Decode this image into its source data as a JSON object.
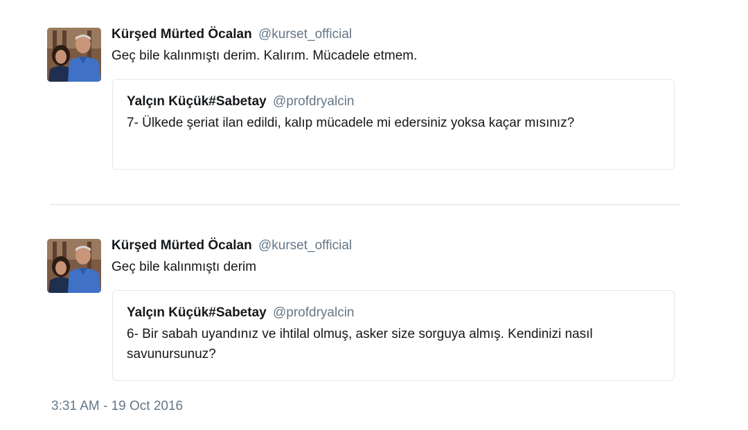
{
  "thread": [
    {
      "author": {
        "name": "Kürşed Mürted Öcalan",
        "handle": "@kurset_official"
      },
      "text": "Geç bile kalınmıştı derim. Kalırım. Mücadele etmem.",
      "quoted": {
        "author": {
          "name": "Yalçın Küçük#Sabetay",
          "handle": "@profdryalcin"
        },
        "text": "7- Ülkede şeriat ilan edildi, kalıp mücadele mi edersiniz yoksa kaçar mısınız?"
      }
    },
    {
      "author": {
        "name": "Kürşed Mürted Öcalan",
        "handle": "@kurset_official"
      },
      "text": "Geç bile kalınmıştı derim",
      "quoted": {
        "author": {
          "name": "Yalçın Küçük#Sabetay",
          "handle": "@profdryalcin"
        },
        "text": "6- Bir sabah uyandınız ve ihtilal olmuş, asker size sorguya almış. Kendinizi nasıl savunursunuz?"
      }
    }
  ],
  "timestamp": "3:31 AM - 19 Oct 2016",
  "colors": {
    "text": "#14171a",
    "secondary": "#657786",
    "border": "#e1e8ed"
  },
  "icons": {
    "avatar": "profile-photo-avatar"
  }
}
